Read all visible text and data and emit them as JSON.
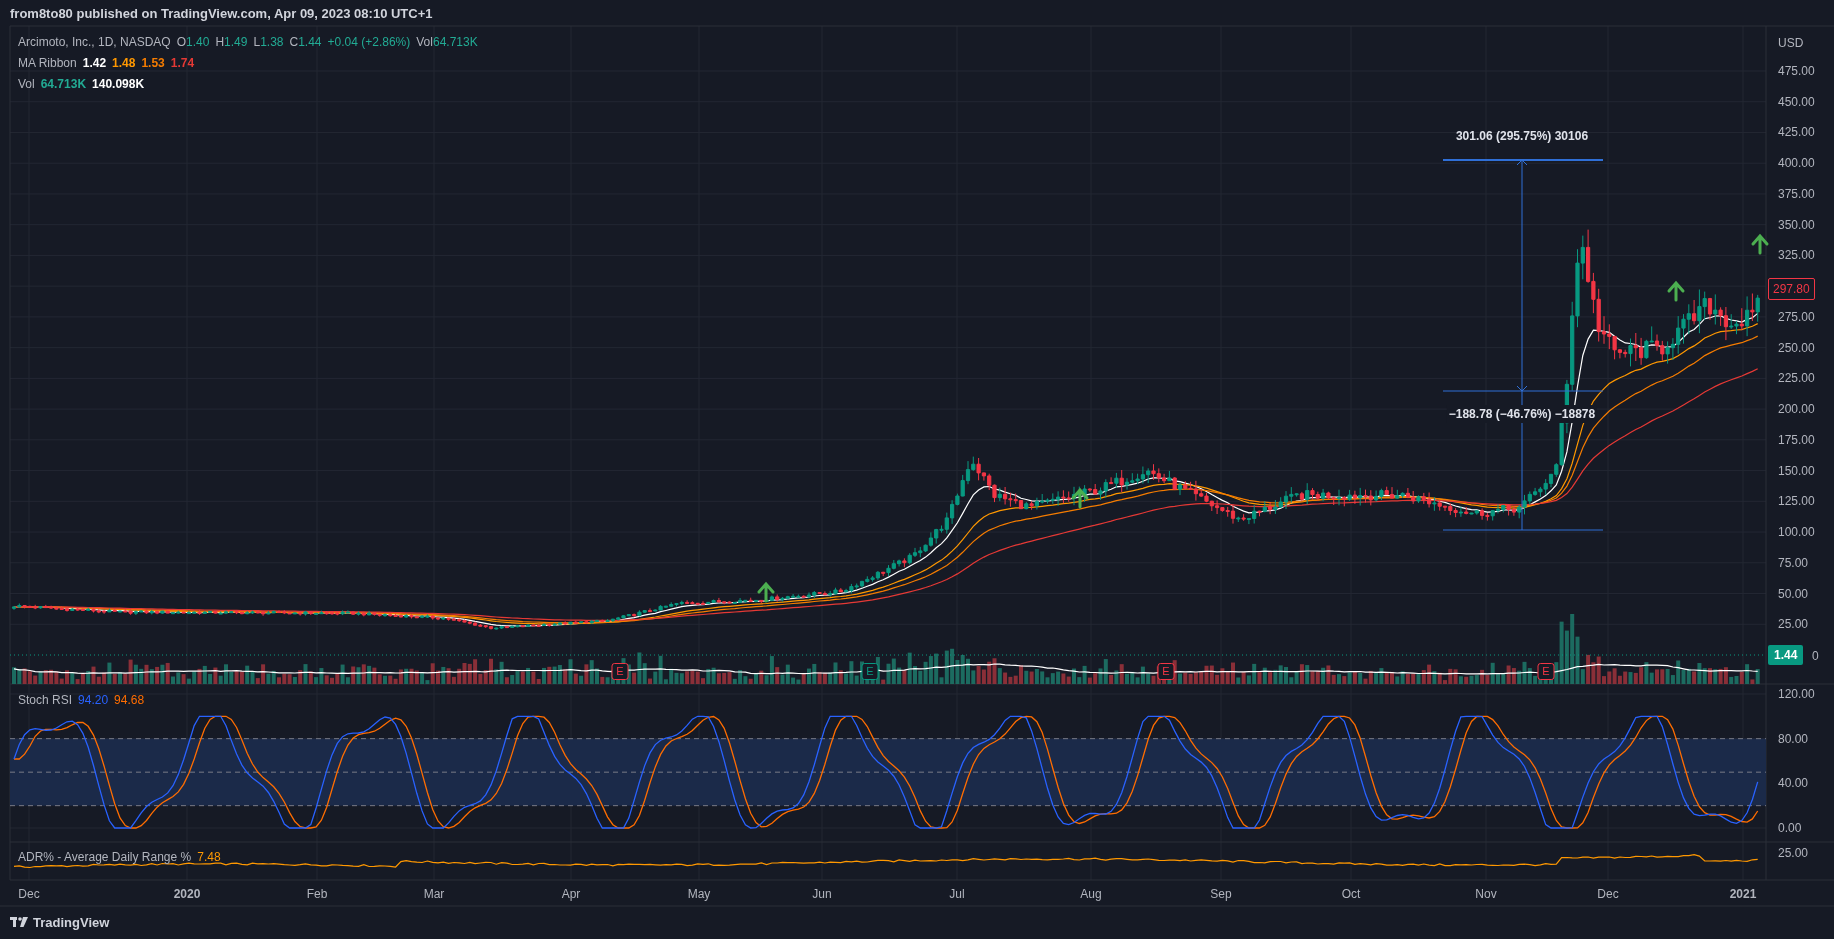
{
  "header": {
    "text": "from8to80 published on TradingView.com, Apr 09, 2023 08:10 UTC+1"
  },
  "legend": {
    "symbol": "Arcimoto, Inc., 1D, NASDAQ",
    "ohlc": [
      {
        "label": "O",
        "value": "1.40"
      },
      {
        "label": "H",
        "value": "1.49"
      },
      {
        "label": "L",
        "value": "1.38"
      },
      {
        "label": "C",
        "value": "1.44"
      }
    ],
    "change": "+0.04 (+2.86%)",
    "volume": {
      "label": "Vol",
      "value": "64.713K"
    }
  },
  "indicators": [
    {
      "name": "MA Ribbon",
      "values": [
        {
          "text": "1.42",
          "color": "#ffffff"
        },
        {
          "text": "1.48",
          "color": "#ff9800"
        },
        {
          "text": "1.53",
          "color": "#f57c00"
        },
        {
          "text": "1.74",
          "color": "#e53935"
        }
      ]
    },
    {
      "name": "Vol",
      "values": [
        {
          "text": "64.713K",
          "color": "#22ab94"
        },
        {
          "text": "140.098K",
          "color": "#ffffff"
        }
      ]
    }
  ],
  "price_axis": {
    "currency": "USD",
    "ticks": [
      "475.00",
      "450.00",
      "425.00",
      "400.00",
      "375.00",
      "350.00",
      "325.00",
      "275.00",
      "250.00",
      "225.00",
      "200.00",
      "175.00",
      "150.00",
      "125.00",
      "100.00",
      "75.00",
      "50.00",
      "25.00"
    ],
    "partial_tick": "0"
  },
  "badges": [
    {
      "text": "297.80",
      "kind": "outline",
      "color": "#f23645"
    },
    {
      "text": "1.44",
      "kind": "filled",
      "color": "#089981"
    }
  ],
  "measure": {
    "upper_label": "301.06 (295.75%) 30106",
    "lower_label": "−188.78 (−46.76%) −18878"
  },
  "earnings": [
    {
      "text": "E",
      "color": "#f23645"
    },
    {
      "text": "E",
      "color": "#089981"
    },
    {
      "text": "E",
      "color": "#f23645"
    },
    {
      "text": "E",
      "color": "#f23645"
    }
  ],
  "rsi": {
    "name": "Stoch RSI",
    "values": [
      {
        "text": "94.20",
        "color": "#2962ff"
      },
      {
        "text": "94.68",
        "color": "#ff6d00"
      }
    ],
    "ticks": [
      "120.00",
      "80.00",
      "40.00",
      "0.00"
    ]
  },
  "adr": {
    "name": "ADR% - Average Daily Range %",
    "value": "7.48",
    "ticks": [
      "25.00"
    ]
  },
  "time_axis": [
    {
      "text": "Dec",
      "year": false
    },
    {
      "text": "2020",
      "year": true
    },
    {
      "text": "Feb",
      "year": false
    },
    {
      "text": "Mar",
      "year": false
    },
    {
      "text": "Apr",
      "year": false
    },
    {
      "text": "May",
      "year": false
    },
    {
      "text": "Jun",
      "year": false
    },
    {
      "text": "Jul",
      "year": false
    },
    {
      "text": "Aug",
      "year": false
    },
    {
      "text": "Sep",
      "year": false
    },
    {
      "text": "Oct",
      "year": false
    },
    {
      "text": "Nov",
      "year": false
    },
    {
      "text": "Dec",
      "year": false
    },
    {
      "text": "2021",
      "year": true
    }
  ],
  "footer": {
    "brand": "TradingView"
  }
}
